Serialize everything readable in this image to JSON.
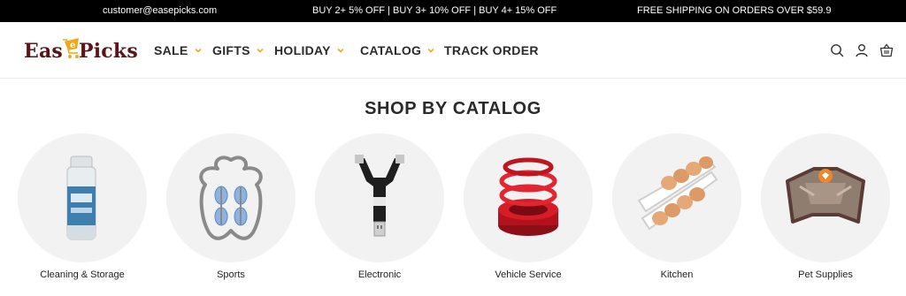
{
  "announcement": {
    "email": "customer@easepicks.com",
    "promo": "BUY 2+ 5% OFF | BUY 3+ 10% OFF | BUY 4+ 15% OFF",
    "shipping": "FREE SHIPPING ON ORDERS OVER $59.9"
  },
  "brand": {
    "logo_left": "Eas",
    "logo_right": "Picks",
    "logo_color": "#5b1418",
    "accent_color": "#f0a81b"
  },
  "nav": {
    "sale": "SALE",
    "gifts": "GIFTS",
    "holiday": "HOLIDAY",
    "catalog": "CATALOG",
    "track": "TRACK ORDER"
  },
  "header_icons": [
    "search-icon",
    "account-icon",
    "cart-icon"
  ],
  "section": {
    "title": "SHOP BY CATALOG"
  },
  "categories": [
    {
      "label": "Cleaning & Storage",
      "icon": "cleaner-bottle-icon"
    },
    {
      "label": "Sports",
      "icon": "massage-roller-icon"
    },
    {
      "label": "Electronic",
      "icon": "card-reader-icon"
    },
    {
      "label": "Vehicle Service",
      "icon": "car-aroma-diffuser-icon"
    },
    {
      "label": "Kitchen",
      "icon": "egg-dispenser-icon"
    },
    {
      "label": "Pet Supplies",
      "icon": "dog-harness-icon"
    }
  ]
}
